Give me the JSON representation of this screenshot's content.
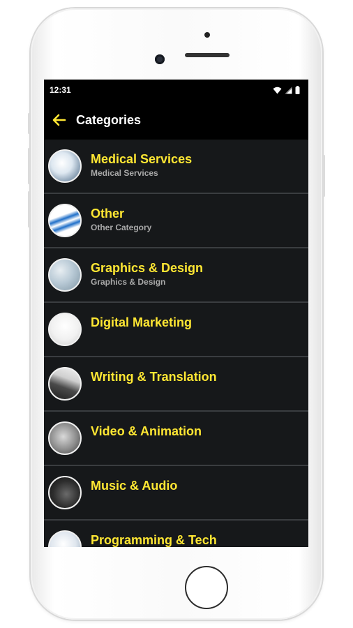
{
  "status_bar": {
    "time": "12:31",
    "icons": [
      "wifi-icon",
      "signal-icon",
      "battery-icon"
    ]
  },
  "app_bar": {
    "back_icon": "arrow-left-icon",
    "title": "Categories"
  },
  "colors": {
    "accent": "#ffe733",
    "list_background": "#16181a",
    "divider": "#3a3d40",
    "screen_background": "#000000"
  },
  "categories": [
    {
      "title": "Medical Services",
      "subtitle": "Medical Services",
      "thumb": "medical-thumbnail"
    },
    {
      "title": "Other",
      "subtitle": "Other Category",
      "thumb": "globe-thumbnail"
    },
    {
      "title": "Graphics & Design",
      "subtitle": "Graphics & Design",
      "thumb": "design-thumbnail"
    },
    {
      "title": "Digital Marketing",
      "subtitle": "",
      "thumb": "marketing-thumbnail"
    },
    {
      "title": "Writing & Translation",
      "subtitle": "",
      "thumb": "writing-thumbnail"
    },
    {
      "title": "Video & Animation",
      "subtitle": "",
      "thumb": "video-thumbnail"
    },
    {
      "title": "Music & Audio",
      "subtitle": "",
      "thumb": "music-thumbnail"
    },
    {
      "title": "Programming & Tech",
      "subtitle": "",
      "thumb": "programming-thumbnail"
    }
  ]
}
